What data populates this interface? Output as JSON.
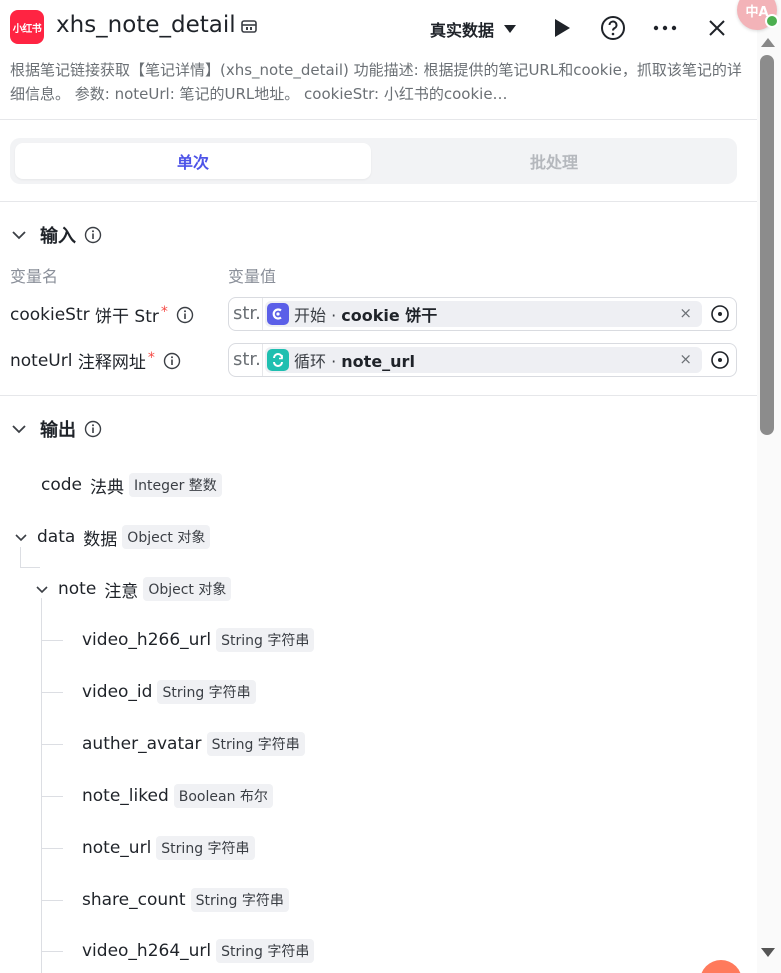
{
  "header": {
    "logo_text": "小红书",
    "title": "xhs_note_detail",
    "data_source_label": "真实数据",
    "icons": [
      "plugin-icon",
      "play-icon",
      "help-icon",
      "more-icon",
      "close-icon"
    ]
  },
  "description": "根据笔记链接获取【笔记详情】(xhs_note_detail) 功能描述: 根据提供的笔记URL和cookie，抓取该笔记的详细信息。 参数: noteUrl: 笔记的URL地址。 cookieStr: 小红书的cookie…",
  "tabs": [
    {
      "label": "单次",
      "active": true
    },
    {
      "label": "批处理",
      "active": false
    }
  ],
  "input": {
    "title": "输入",
    "col_name": "变量名",
    "col_value": "变量值",
    "rows": [
      {
        "name": "cookieStr",
        "cn": "饼干 Str",
        "required_mark": "*",
        "type": "str.",
        "node": "开始",
        "node_sep": " · ",
        "value": "cookie  饼干",
        "node_color": "#5b5fe8"
      },
      {
        "name": "noteUrl",
        "cn": "注释网址",
        "required_mark": "*",
        "type": "str.",
        "node": "循环",
        "node_sep": " · ",
        "value": "note_url",
        "node_color": "#1fbfb0"
      }
    ],
    "clear_glyph": "×"
  },
  "output": {
    "title": "输出",
    "items": [
      {
        "name": "code",
        "cn": "法典",
        "type": "Integer 整数"
      },
      {
        "name": "data",
        "cn": "数据",
        "type": "Object 对象"
      },
      {
        "name": "note",
        "cn": "注意",
        "type": "Object 对象"
      },
      {
        "name": "video_h266_url",
        "type": "String 字符串"
      },
      {
        "name": "video_id",
        "type": "String 字符串"
      },
      {
        "name": "auther_avatar",
        "type": "String 字符串"
      },
      {
        "name": "note_liked",
        "type": "Boolean 布尔"
      },
      {
        "name": "note_url",
        "type": "String 字符串"
      },
      {
        "name": "share_count",
        "type": "String 字符串"
      },
      {
        "name": "video_h264_url",
        "type": "String 字符串"
      }
    ]
  },
  "translate_badge": "中A"
}
